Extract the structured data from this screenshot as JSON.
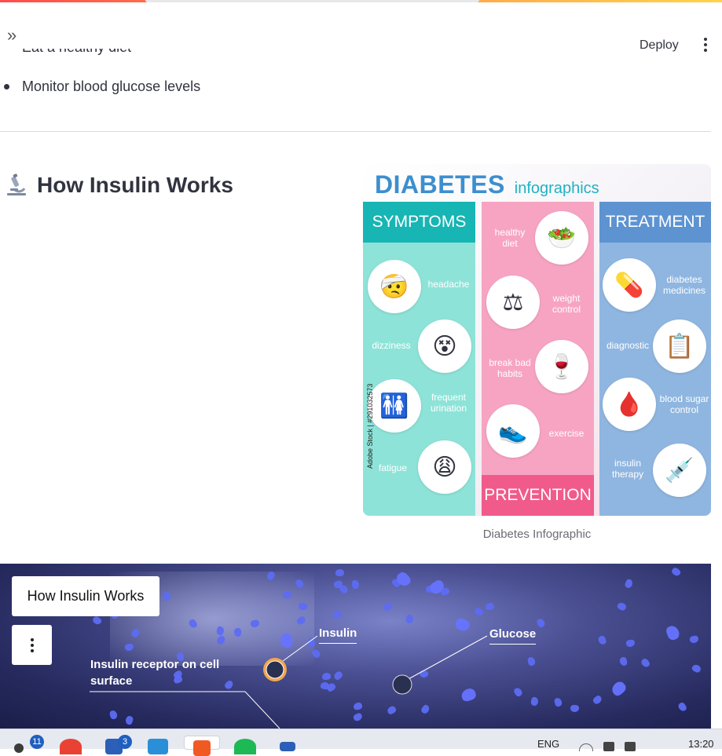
{
  "header": {
    "deploy_label": "Deploy",
    "sidebar_toggle_glyph": "»"
  },
  "content": {
    "clipped_item": "Eat a healthy diet",
    "bullet_item": "Monitor blood glucose levels",
    "section_icon": "microscope-icon",
    "section_title": "How Insulin Works",
    "image_caption": "Diabetes Infographic"
  },
  "infographic": {
    "title_big": "DIABETES",
    "title_small": "infographics",
    "symptoms": {
      "heading": "SYMPTOMS",
      "items": [
        "headache",
        "dizziness",
        "frequent urination",
        "fatigue"
      ]
    },
    "prevention": {
      "heading": "PREVENTION",
      "items": [
        "healthy diet",
        "weight control",
        "break bad habits",
        "exercise"
      ]
    },
    "treatment": {
      "heading": "TREATMENT",
      "items": [
        "diabetes medicines",
        "diagnostic",
        "blood sugar control",
        "insulin therapy"
      ]
    },
    "watermark": "Adobe Stock | #291032573",
    "colors": {
      "symptoms": "#17b5b4",
      "prevention": "#f05b8b",
      "treatment": "#5d93d1"
    }
  },
  "video": {
    "title": "How Insulin Works",
    "labels": {
      "insulin": "Insulin",
      "glucose": "Glucose",
      "receptor": "Insulin receptor on cell surface"
    }
  },
  "taskbar": {
    "badge_mail": "11",
    "badge_teams": "3",
    "language": "ENG",
    "time": "13:20"
  }
}
